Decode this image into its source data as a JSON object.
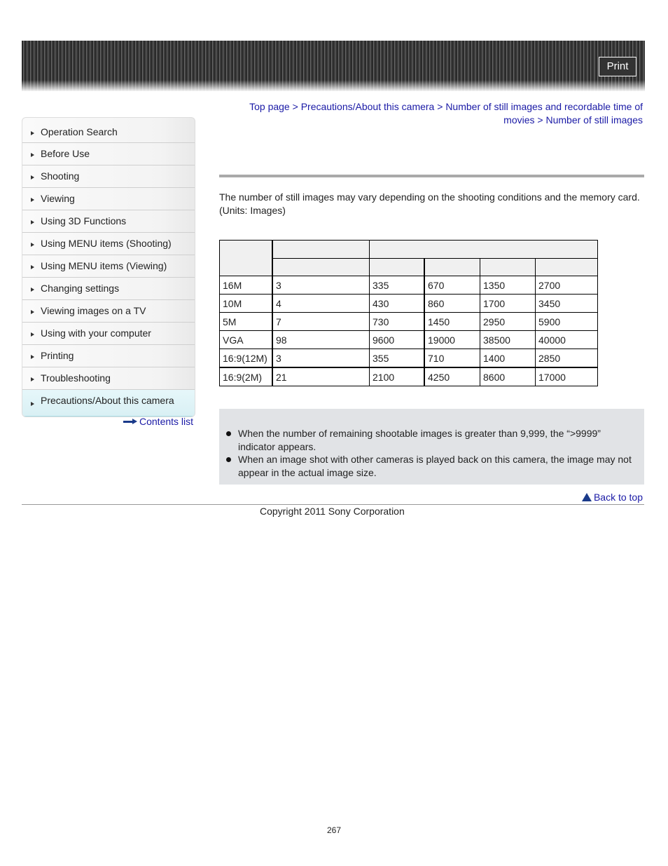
{
  "header": {
    "print_label": "Print"
  },
  "sidebar": {
    "items": [
      {
        "label": "Operation Search",
        "active": false
      },
      {
        "label": "Before Use",
        "active": false
      },
      {
        "label": "Shooting",
        "active": false
      },
      {
        "label": "Viewing",
        "active": false
      },
      {
        "label": "Using 3D Functions",
        "active": false
      },
      {
        "label": "Using MENU items (Shooting)",
        "active": false
      },
      {
        "label": "Using MENU items (Viewing)",
        "active": false
      },
      {
        "label": "Changing settings",
        "active": false
      },
      {
        "label": "Viewing images on a TV",
        "active": false
      },
      {
        "label": "Using with your computer",
        "active": false
      },
      {
        "label": "Printing",
        "active": false
      },
      {
        "label": "Troubleshooting",
        "active": false
      },
      {
        "label": "Precautions/About this camera",
        "active": true
      }
    ],
    "contents_list_label": "Contents list"
  },
  "breadcrumb": {
    "items": [
      "Top page",
      "Precautions/About this camera",
      "Number of still images and recordable time of movies",
      "Number of still images"
    ],
    "separator": ">"
  },
  "main": {
    "intro_line1": "The number of still images may vary depending on the shooting conditions and the memory card.",
    "intro_line2": "(Units: Images)"
  },
  "table": {
    "rows": [
      [
        "16M",
        "3",
        "335",
        "670",
        "1350",
        "2700"
      ],
      [
        "10M",
        "4",
        "430",
        "860",
        "1700",
        "3450"
      ],
      [
        "5M",
        "7",
        "730",
        "1450",
        "2950",
        "5900"
      ],
      [
        "VGA",
        "98",
        "9600",
        "19000",
        "38500",
        "40000"
      ],
      [
        "16:9(12M)",
        "3",
        "355",
        "710",
        "1400",
        "2850"
      ],
      [
        "16:9(2M)",
        "21",
        "2100",
        "4250",
        "8600",
        "17000"
      ]
    ]
  },
  "notes": {
    "items": [
      "When the number of remaining shootable images is greater than 9,999, the “>9999” indicator appears.",
      "When an image shot with other cameras is played back on this camera, the image may not appear in the actual image size."
    ]
  },
  "footer": {
    "back_to_top_label": "Back to top",
    "copyright": "Copyright 2011 Sony Corporation",
    "page_number": "267"
  }
}
